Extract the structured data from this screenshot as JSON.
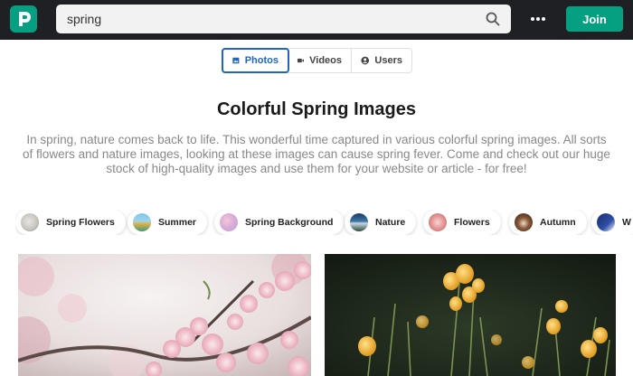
{
  "header": {
    "search": {
      "value": "spring",
      "placeholder": ""
    },
    "join_label": "Join"
  },
  "tabs": [
    {
      "label": "Photos",
      "icon": "image-icon",
      "active": true
    },
    {
      "label": "Videos",
      "icon": "video-camera-icon",
      "active": false
    },
    {
      "label": "Users",
      "icon": "user-circle-icon",
      "active": false
    }
  ],
  "main": {
    "title": "Colorful Spring Images",
    "description": "In spring, nature comes back to life. This wonderful time captured in various colorful spring images. All sorts of flowers and nature images, looking at these images can cause spring fever. Come and check out our huge stock of high-quality images and use them for your website or article - for free!"
  },
  "chips": [
    {
      "label": "Spring Flowers"
    },
    {
      "label": "Summer"
    },
    {
      "label": "Spring Background"
    },
    {
      "label": "Nature"
    },
    {
      "label": "Flowers"
    },
    {
      "label": "Autumn"
    },
    {
      "label": "W"
    }
  ],
  "colors": {
    "brand": "#05a081",
    "header_bg": "#1f2023",
    "tab_active": "#1e66c4",
    "description_text": "#888888"
  }
}
